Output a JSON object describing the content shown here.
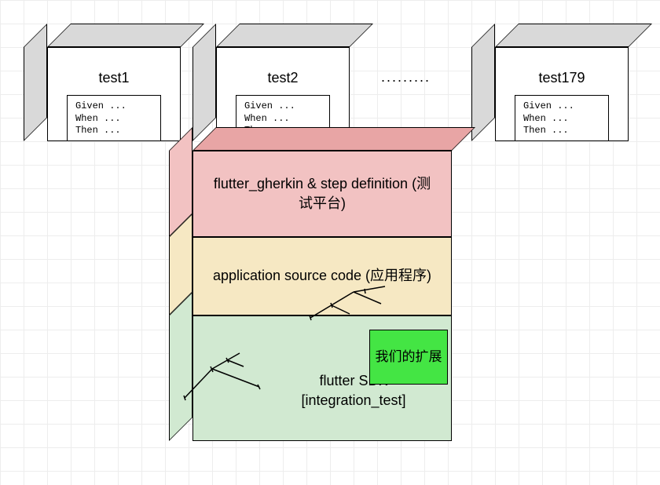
{
  "tests": [
    {
      "name": "test1",
      "lines": [
        "Given ...",
        "When ...",
        "Then ..."
      ]
    },
    {
      "name": "test2",
      "lines": [
        "Given ...",
        "When ...",
        "Then ..."
      ]
    },
    {
      "name": "test179",
      "lines": [
        "Given ...",
        "When ...",
        "Then ..."
      ]
    }
  ],
  "ellipsis": ".........",
  "layers": {
    "gherkin": "flutter_gherkin & step definition (测试平台)",
    "app": "application source code (应用程序)",
    "sdk": "flutter SDK [integration_test]"
  },
  "extension": "我们的扩展"
}
